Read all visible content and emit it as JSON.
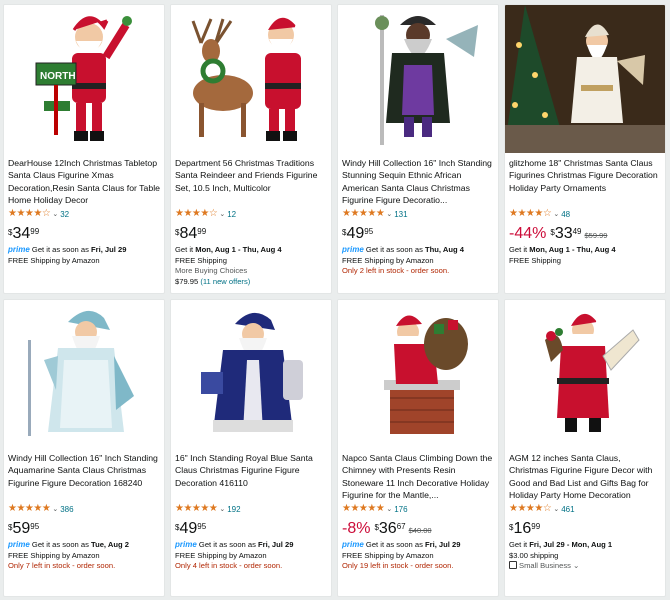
{
  "products": [
    {
      "title": "DearHouse 12Inch Christmas Tabletop Santa Claus Figurine Xmas Decoration,Resin Santa Claus for Table Home Holiday Decor",
      "stars": "★★★★☆",
      "review_count": "32",
      "price_symbol": "$",
      "price_whole": "34",
      "price_fraction": "99",
      "lines": [
        {
          "prime": "prime",
          "text": " Get it as soon as ",
          "bold": "Fri, Jul 29"
        },
        {
          "text": "FREE Shipping by Amazon"
        }
      ],
      "image": "santa-north-sign"
    },
    {
      "title": "Department 56 Christmas Traditions Santa Reindeer and Friends Figurine Set, 10.5 Inch, Multicolor",
      "stars": "★★★★☆",
      "review_count": "12",
      "price_symbol": "$",
      "price_whole": "84",
      "price_fraction": "99",
      "lines": [
        {
          "text": "Get it ",
          "bold": "Mon, Aug 1 - Thu, Aug 4"
        },
        {
          "text": "FREE Shipping"
        },
        {
          "text": "More Buying Choices",
          "style": "gray"
        },
        {
          "text": "$79.95 ",
          "teal": "(11 new offers)"
        }
      ],
      "image": "santa-reindeer"
    },
    {
      "title": "Windy Hill Collection 16\" Inch Standing Stunning Sequin Ethnic African American Santa Claus Christmas Figurine Figure Decoratio...",
      "stars": "★★★★★",
      "review_count": "131",
      "price_symbol": "$",
      "price_whole": "49",
      "price_fraction": "95",
      "lines": [
        {
          "prime": "prime",
          "text": " Get it as soon as ",
          "bold": "Thu, Aug 4"
        },
        {
          "text": "FREE Shipping by Amazon"
        },
        {
          "text": "Only 2 left in stock - order soon.",
          "style": "red"
        }
      ],
      "image": "santa-black-robe"
    },
    {
      "title": "glitzhome 18\" Christmas Santa Claus Figurines Christmas Figure Decoration Holiday Party Ornaments",
      "stars": "★★★★☆",
      "review_count": "48",
      "discount": "-44%",
      "price_symbol": "$",
      "price_whole": "33",
      "price_fraction": "49",
      "list_price": "$59.99",
      "lines": [
        {
          "text": "Get it ",
          "bold": "Mon, Aug 1 - Thu, Aug 4"
        },
        {
          "text": "FREE Shipping"
        }
      ],
      "image": "santa-white-tree"
    },
    {
      "title": "Windy Hill Collection 16\" Inch Standing Aquamarine Santa Claus Christmas Figurine Figure Decoration 168240",
      "stars": "★★★★★",
      "review_count": "386",
      "price_symbol": "$",
      "price_whole": "59",
      "price_fraction": "95",
      "lines": [
        {
          "prime": "prime",
          "text": " Get it as soon as ",
          "bold": "Tue, Aug 2"
        },
        {
          "text": "FREE Shipping by Amazon"
        },
        {
          "text": "Only 7 left in stock - order soon.",
          "style": "red"
        }
      ],
      "image": "santa-aquamarine"
    },
    {
      "title": "16\" Inch Standing Royal Blue Santa Claus Christmas Figurine Figure Decoration 416110",
      "stars": "★★★★★",
      "review_count": "192",
      "price_symbol": "$",
      "price_whole": "49",
      "price_fraction": "95",
      "lines": [
        {
          "prime": "prime",
          "text": " Get it as soon as ",
          "bold": "Fri, Jul 29"
        },
        {
          "text": "FREE Shipping by Amazon"
        },
        {
          "text": "Only 4 left in stock - order soon.",
          "style": "red"
        }
      ],
      "image": "santa-royal-blue"
    },
    {
      "title": "Napco Santa Claus Climbing Down the Chimney with Presents Resin Stoneware 11 Inch Decorative Holiday Figurine for the Mantle,...",
      "stars": "★★★★★",
      "review_count": "176",
      "discount": "-8%",
      "price_symbol": "$",
      "price_whole": "36",
      "price_fraction": "67",
      "list_price": "$40.00",
      "lines": [
        {
          "prime": "prime",
          "text": " Get it as soon as ",
          "bold": "Fri, Jul 29"
        },
        {
          "text": "FREE Shipping by Amazon"
        },
        {
          "text": "Only 19 left in stock - order soon.",
          "style": "red"
        }
      ],
      "image": "santa-chimney"
    },
    {
      "title": "AGM 12 inches Santa Claus, Christmas Figurine Figure Decor with Good and Bad List and Gifts Bag for Holiday Party Home Decoration",
      "stars": "★★★★☆",
      "review_count": "461",
      "price_symbol": "$",
      "price_whole": "16",
      "price_fraction": "99",
      "lines": [
        {
          "text": "Get it ",
          "bold": "Fri, Jul 29 - Mon, Aug 1"
        },
        {
          "text": "$3.00 shipping"
        },
        {
          "icon": "small-business-icon",
          "text": "Small Business ⌄",
          "style": "gray"
        }
      ],
      "image": "santa-list"
    }
  ],
  "colors": {
    "star": "#de7921",
    "prime": "#1a98ff",
    "link": "#007185",
    "deal": "#cc0c39",
    "stock": "#b12704"
  }
}
